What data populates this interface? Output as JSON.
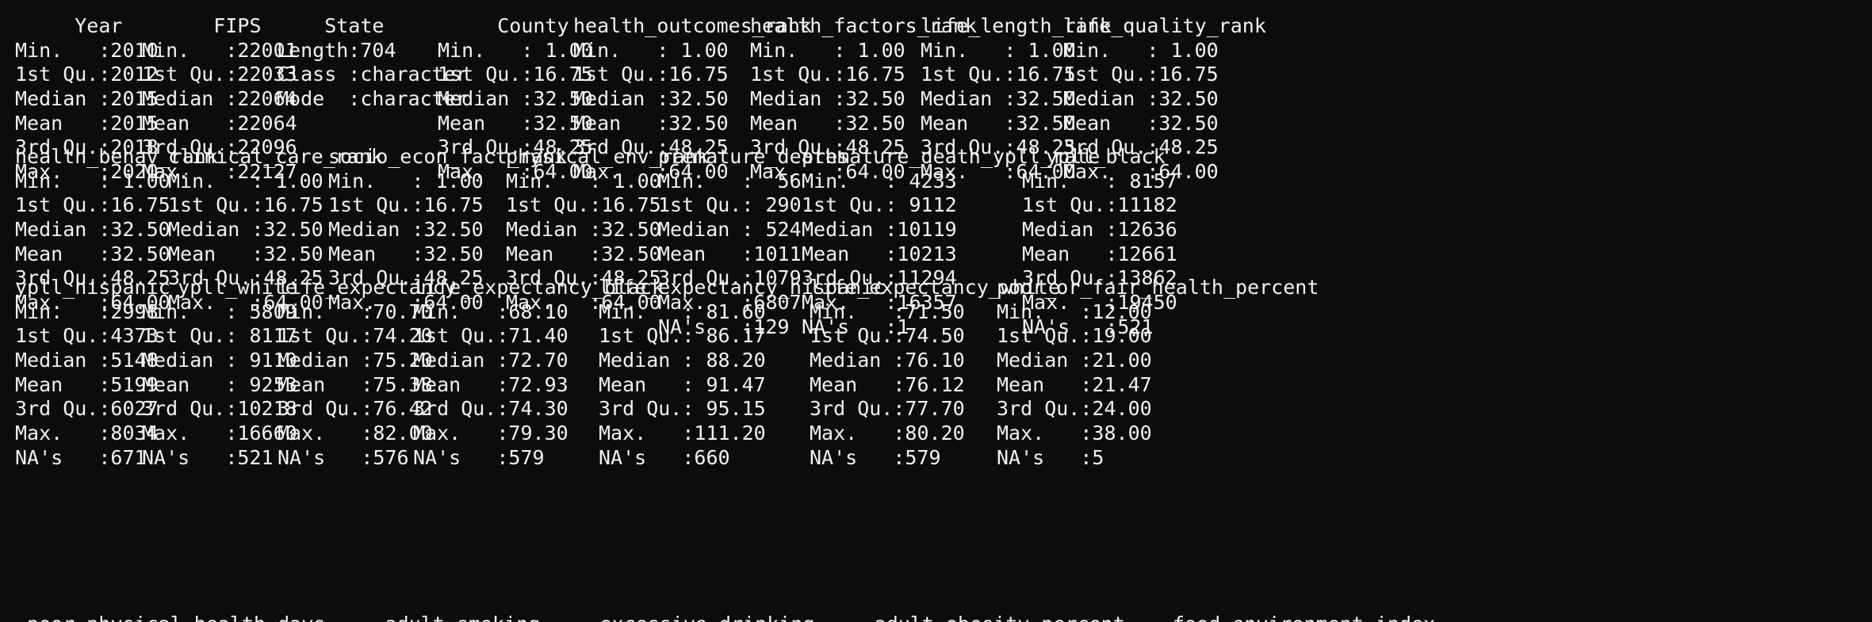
{
  "summary_blocks": [
    {
      "columns": [
        {
          "header": "     Year",
          "lines": [
            "Min.   :2010",
            "1st Qu.:2012",
            "Median :2015",
            "Mean   :2015",
            "3rd Qu.:2018",
            "Max.   :2020"
          ]
        },
        {
          "header": "      FIPS",
          "lines": [
            "Min.   :22001",
            "1st Qu.:22033",
            "Median :22064",
            "Mean   :22064",
            "3rd Qu.:22096",
            "Max.   :22127"
          ]
        },
        {
          "header": "    State",
          "lines": [
            "Length:704",
            "Class :character",
            "Mode  :character"
          ]
        },
        {
          "header": "     County",
          "lines": [
            "Min.   : 1.00",
            "1st Qu.:16.75",
            "Median :32.50",
            "Mean   :32.50",
            "3rd Qu.:48.25",
            "Max.   :64.00"
          ]
        },
        {
          "header": "health_outcomes_rank",
          "lines": [
            "Min.   : 1.00",
            "1st Qu.:16.75",
            "Median :32.50",
            "Mean   :32.50",
            "3rd Qu.:48.25",
            "Max.   :64.00"
          ]
        },
        {
          "header": "health_factors_rank",
          "lines": [
            "Min.   : 1.00",
            "1st Qu.:16.75",
            "Median :32.50",
            "Mean   :32.50",
            "3rd Qu.:48.25",
            "Max.   :64.00"
          ]
        },
        {
          "header": "life_length_rank",
          "lines": [
            "Min.   : 1.00",
            "1st Qu.:16.75",
            "Median :32.50",
            "Mean   :32.50",
            "3rd Qu.:48.25",
            "Max.   :64.00"
          ]
        },
        {
          "header": "life_quality_rank",
          "lines": [
            "Min.   : 1.00",
            "1st Qu.:16.75",
            "Median :32.50",
            "Mean   :32.50",
            "3rd Qu.:48.25",
            "Max.   :64.00"
          ]
        }
      ]
    },
    {
      "columns": [
        {
          "header": "health_behav_rank",
          "lines": [
            "Min.   : 1.00",
            "1st Qu.:16.75",
            "Median :32.50",
            "Mean   :32.50",
            "3rd Qu.:48.25",
            "Max.   :64.00"
          ]
        },
        {
          "header": "clinical_care_rank",
          "lines": [
            "Min.   : 1.00",
            "1st Qu.:16.75",
            "Median :32.50",
            "Mean   :32.50",
            "3rd Qu.:48.25",
            "Max.   :64.00"
          ]
        },
        {
          "header": "socio_econ_fact_rank",
          "lines": [
            "Min.   : 1.00",
            "1st Qu.:16.75",
            "Median :32.50",
            "Mean   :32.50",
            "3rd Qu.:48.25",
            "Max.   :64.00"
          ]
        },
        {
          "header": "physical_env_rank",
          "lines": [
            "Min.   : 1.00",
            "1st Qu.:16.75",
            "Median :32.50",
            "Mean   :32.50",
            "3rd Qu.:48.25",
            "Max.   :64.00"
          ]
        },
        {
          "header": "premature_deaths",
          "lines": [
            "Min.   :  56",
            "1st Qu.: 290",
            "Median : 524",
            "Mean   :1011",
            "3rd Qu.:1079",
            "Max.   :6807",
            "NA's   :129"
          ]
        },
        {
          "header": "premature_death_ypll_rate",
          "lines": [
            "Min.   : 4233",
            "1st Qu.: 9112",
            "Median :10119",
            "Mean   :10213",
            "3rd Qu.:11294",
            "Max.   :16357",
            "NA's   :1"
          ]
        },
        {
          "header": "  ypll_black",
          "lines": [
            "Min.   : 8157",
            "1st Qu.:11182",
            "Median :12636",
            "Mean   :12661",
            "3rd Qu.:13862",
            "Max.   :19450",
            "NA's   :521"
          ]
        }
      ]
    },
    {
      "columns": [
        {
          "header": "ypll_hispanic",
          "lines": [
            "Min.   :2998",
            "1st Qu.:4373",
            "Median :5148",
            "Mean   :5199",
            "3rd Qu.:6027",
            "Max.   :8034",
            "NA's   :671"
          ]
        },
        {
          "header": "   ypll_white",
          "lines": [
            "Min.   : 5809",
            "1st Qu.: 8117",
            "Median : 9110",
            "Mean   : 9253",
            "3rd Qu.:10218",
            "Max.   :16660",
            "NA's   :521"
          ]
        },
        {
          "header": "life_expectancy",
          "lines": [
            "Min.   :70.70",
            "1st Qu.:74.20",
            "Median :75.20",
            "Mean   :75.38",
            "3rd Qu.:76.42",
            "Max.   :82.00",
            "NA's   :576"
          ]
        },
        {
          "header": "life_expectancy_black",
          "lines": [
            "Min.   :68.10",
            "1st Qu.:71.40",
            "Median :72.70",
            "Mean   :72.93",
            "3rd Qu.:74.30",
            "Max.   :79.30",
            "NA's   :579"
          ]
        },
        {
          "header": "life_expectancy_hispanic",
          "lines": [
            "Min.   : 81.60",
            "1st Qu.: 86.17",
            "Median : 88.20",
            "Mean   : 91.47",
            "3rd Qu.: 95.15",
            "Max.   :111.20",
            "NA's   :660"
          ]
        },
        {
          "header": "life_expectancy_white",
          "lines": [
            "Min.   :71.50",
            "1st Qu.:74.50",
            "Median :76.10",
            "Mean   :76.12",
            "3rd Qu.:77.70",
            "Max.   :80.20",
            "NA's   :579"
          ]
        },
        {
          "header": "poor_or_fair_health_percent",
          "lines": [
            "Min.   :12.00",
            "1st Qu.:19.00",
            "Median :21.00",
            "Mean   :21.47",
            "3rd Qu.:24.00",
            "Max.   :38.00",
            "NA's   :5"
          ]
        }
      ]
    }
  ],
  "cut_off_line": " poor_physical_health_days     adult_smoking     excessive_drinking     adult_obesity_percent    food_environment_index     "
}
